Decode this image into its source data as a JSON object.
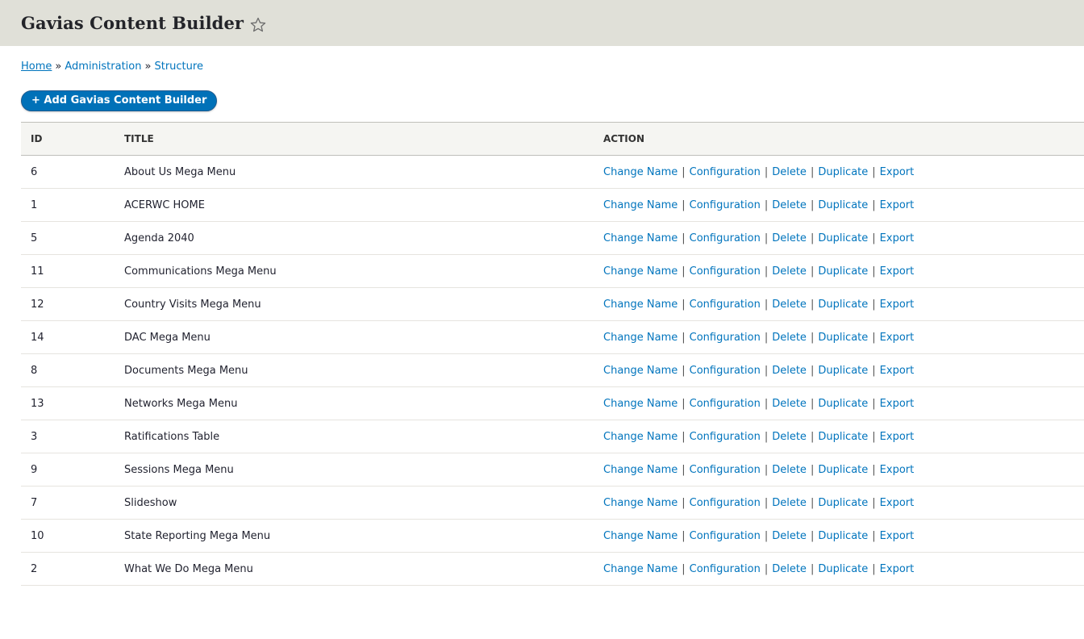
{
  "header": {
    "title": "Gavias Content Builder"
  },
  "breadcrumb": [
    {
      "label": "Home"
    },
    {
      "label": "Administration"
    },
    {
      "label": "Structure"
    }
  ],
  "breadcrumb_separator": "»",
  "add_button": {
    "label": "+ Add Gavias Content Builder"
  },
  "table": {
    "columns": [
      "ID",
      "TITLE",
      "ACTION"
    ],
    "actions": [
      "Change Name",
      "Configuration",
      "Delete",
      "Duplicate",
      "Export"
    ],
    "rows": [
      {
        "id": "6",
        "title": "About Us Mega Menu"
      },
      {
        "id": "1",
        "title": "ACERWC HOME"
      },
      {
        "id": "5",
        "title": "Agenda 2040"
      },
      {
        "id": "11",
        "title": "Communications Mega Menu"
      },
      {
        "id": "12",
        "title": "Country Visits Mega Menu"
      },
      {
        "id": "14",
        "title": "DAC Mega Menu"
      },
      {
        "id": "8",
        "title": "Documents Mega Menu"
      },
      {
        "id": "13",
        "title": "Networks Mega Menu"
      },
      {
        "id": "3",
        "title": "Ratifications Table"
      },
      {
        "id": "9",
        "title": "Sessions Mega Menu"
      },
      {
        "id": "7",
        "title": "Slideshow"
      },
      {
        "id": "10",
        "title": "State Reporting Mega Menu"
      },
      {
        "id": "2",
        "title": "What We Do Mega Menu"
      }
    ]
  },
  "colors": {
    "header_bg": "#e0e0d8",
    "link": "#0074bd",
    "button_bg": "#0071b8"
  },
  "icons": {
    "favorite": "star-outline-icon"
  }
}
